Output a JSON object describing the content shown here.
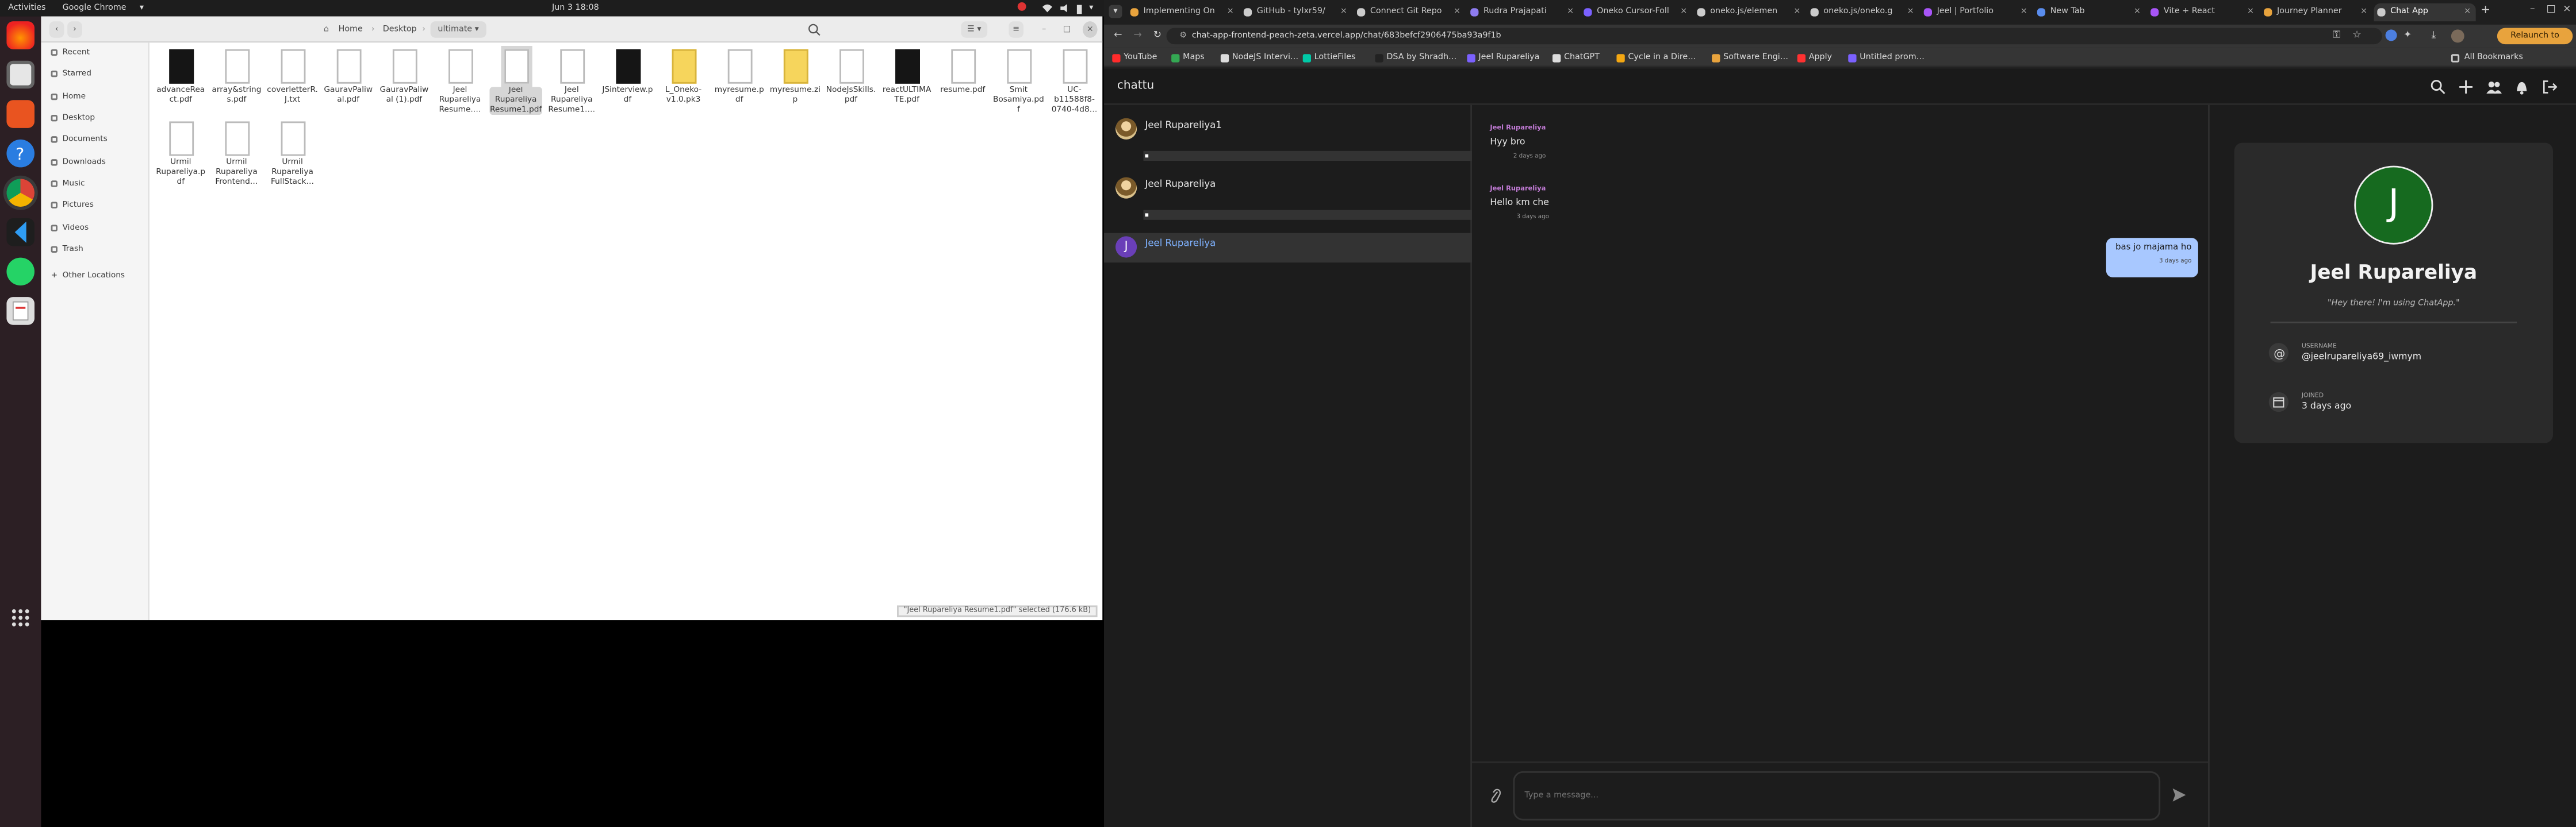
{
  "topbar": {
    "activities": "Activities",
    "app_menu": "Google Chrome",
    "clock": "Jun 3  18:08"
  },
  "filemanager": {
    "breadcrumbs": [
      "Home",
      "Desktop",
      "ultimate"
    ],
    "sidebar": [
      "Recent",
      "Starred",
      "Home",
      "Desktop",
      "Documents",
      "Downloads",
      "Music",
      "Pictures",
      "Videos",
      "Trash",
      "Other Locations"
    ],
    "files": [
      {
        "name": "advanceReact.pdf",
        "type": "dark"
      },
      {
        "name": "array&strings.pdf",
        "type": "doc"
      },
      {
        "name": "coverletterR.J.txt",
        "type": "doc"
      },
      {
        "name": "GauravPaliwal.pdf",
        "type": "doc"
      },
      {
        "name": "GauravPaliwal (1).pdf",
        "type": "doc"
      },
      {
        "name": "Jeel Rupareliya Resume.…",
        "type": "doc"
      },
      {
        "name": "Jeel Rupareliya Resume1.pdf",
        "type": "doc",
        "selected": true
      },
      {
        "name": "Jeel Rupareliya Resume1.…",
        "type": "doc"
      },
      {
        "name": "JSinterview.pdf",
        "type": "dark"
      },
      {
        "name": "L_Oneko-v1.0.pk3",
        "type": "yel"
      },
      {
        "name": "myresume.pdf",
        "type": "doc"
      },
      {
        "name": "myresume.zip",
        "type": "yel"
      },
      {
        "name": "NodeJsSkills.pdf",
        "type": "doc"
      },
      {
        "name": "reactULTIMATE.pdf",
        "type": "dark"
      },
      {
        "name": "resume.pdf",
        "type": "doc"
      },
      {
        "name": "Smit Bosamiya.pdf",
        "type": "doc"
      },
      {
        "name": "UC-b11588f8-0740-4d8…",
        "type": "doc"
      },
      {
        "name": "Urmil Rupareliya.pdf",
        "type": "doc"
      },
      {
        "name": "Urmil Rupareliya Frontend…",
        "type": "doc"
      },
      {
        "name": "Urmil Rupareliya FullStack…",
        "type": "doc"
      }
    ],
    "status": "\"Jeel Rupareliya Resume1.pdf\" selected (176.6 kB)"
  },
  "browser": {
    "tabs": [
      {
        "title": "Implementing On",
        "color": "#e8a33d"
      },
      {
        "title": "GitHub - tylxr59/",
        "color": "#cccccc"
      },
      {
        "title": "Connect Git Repo",
        "color": "#cccccc"
      },
      {
        "title": "Rudra Prajapati",
        "color": "#8e7cf0"
      },
      {
        "title": "Oneko Cursor-Foll",
        "color": "#7b61ff"
      },
      {
        "title": "oneko.js/elemen",
        "color": "#cccccc"
      },
      {
        "title": "oneko.js/oneko.g",
        "color": "#cccccc"
      },
      {
        "title": "Jeel | Portfolio",
        "color": "#a855f7"
      },
      {
        "title": "New Tab",
        "color": "#5a8dee"
      },
      {
        "title": "Vite + React",
        "color": "#a855f7"
      },
      {
        "title": "Journey Planner",
        "color": "#e8a33d"
      },
      {
        "title": "Chat App",
        "color": "#cccccc"
      }
    ],
    "url": "chat-app-frontend-peach-zeta.vercel.app/chat/683befcf2906475ba93a9f1b",
    "relaunch": "Relaunch to update",
    "bookmarks": [
      {
        "label": "YouTube",
        "color": "#ff2b2b"
      },
      {
        "label": "Maps",
        "color": "#34a853"
      },
      {
        "label": "NodeJS Intervi…",
        "color": "#dddddd"
      },
      {
        "label": "LottieFiles",
        "color": "#00c9a7"
      },
      {
        "label": "DSA by Shradh…",
        "color": "#222222"
      },
      {
        "label": "Jeel Rupareliya",
        "color": "#7b61ff"
      },
      {
        "label": "ChatGPT",
        "color": "#dddddd"
      },
      {
        "label": "Cycle in a Dire…",
        "color": "#f3a712"
      },
      {
        "label": "Software Engi…",
        "color": "#e8a33d"
      },
      {
        "label": "Apply",
        "color": "#ff3131"
      },
      {
        "label": "Untitled prom…",
        "color": "#7b61ff"
      }
    ],
    "all_bookmarks": "All Bookmarks"
  },
  "chat": {
    "logo": "chattu",
    "conversations": [
      {
        "name": "Jeel Rupareliya1",
        "avatar": "photo"
      },
      {
        "name": "Jeel Rupareliya",
        "avatar": "photo"
      },
      {
        "name": "Jeel Rupareliya",
        "avatar": "J",
        "active": true
      }
    ],
    "messages": [
      {
        "sender": "Jeel Rupareliya",
        "text": "Hyy bro",
        "time": "2 days ago"
      },
      {
        "sender": "Jeel Rupareliya",
        "text": "Hello km che",
        "time": "3 days ago"
      }
    ],
    "own_message": {
      "text": "bas jo majama ho",
      "time": "3 days ago"
    },
    "input_placeholder": "Type a message...",
    "profile": {
      "initial": "J",
      "name": "Jeel Rupareliya",
      "bio": "\"Hey there! I'm using ChatApp.\"",
      "username_label": "USERNAME",
      "username": "@jeelrupareliya69_iwmym",
      "joined_label": "JOINED",
      "joined": "3 days ago"
    }
  }
}
